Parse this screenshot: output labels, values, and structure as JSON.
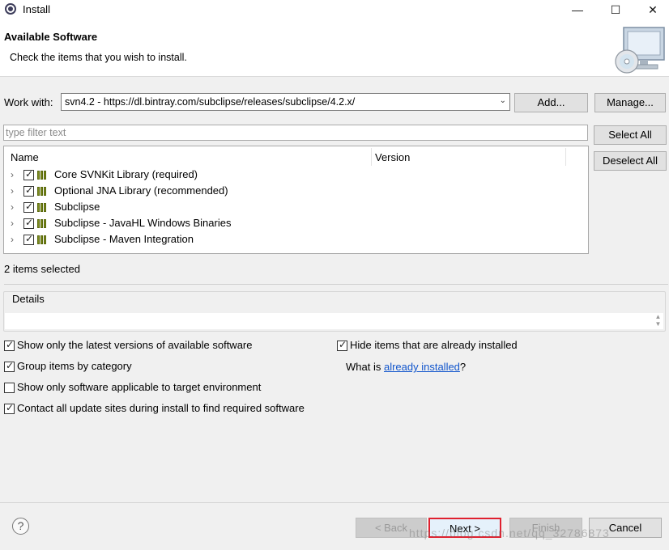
{
  "window": {
    "title": "Install",
    "minimize": "—",
    "maximize": "☐",
    "close": "✕"
  },
  "header": {
    "title": "Available Software",
    "description": "Check the items that you wish to install.",
    "banner_icon": "install-cd-monitor-icon"
  },
  "work_with": {
    "label": "Work with:",
    "value": "svn4.2 - https://dl.bintray.com/subclipse/releases/subclipse/4.2.x/",
    "add_label": "Add...",
    "manage_label": "Manage..."
  },
  "filter": {
    "placeholder": "type filter text",
    "value": ""
  },
  "side_buttons": {
    "select_all": "Select All",
    "deselect_all": "Deselect All"
  },
  "tree": {
    "columns": [
      "Name",
      "Version"
    ],
    "items": [
      {
        "label": "Core SVNKit Library (required)",
        "checked": true
      },
      {
        "label": "Optional JNA Library (recommended)",
        "checked": true
      },
      {
        "label": "Subclipse",
        "checked": true
      },
      {
        "label": "Subclipse - JavaHL Windows Binaries",
        "checked": true
      },
      {
        "label": "Subclipse - Maven Integration",
        "checked": true
      }
    ]
  },
  "status": "2 items selected",
  "details": {
    "label": "Details",
    "value": ""
  },
  "options": {
    "latest_only": {
      "label": "Show only the latest versions of available software",
      "checked": true
    },
    "group_by_category": {
      "label": "Group items by category",
      "checked": true
    },
    "target_env_only": {
      "label": "Show only software applicable to target environment",
      "checked": false
    },
    "contact_all_sites": {
      "label": "Contact all update sites during install to find required software",
      "checked": true
    },
    "hide_installed": {
      "label": "Hide items that are already installed",
      "checked": true
    }
  },
  "what_is": {
    "prefix": "What is ",
    "link": "already installed",
    "suffix": "?"
  },
  "footer": {
    "help_icon": "help-question-icon",
    "back_label": "< Back",
    "next_label": "Next >",
    "finish_label": "Finish",
    "cancel_label": "Cancel"
  },
  "watermark": "https://blog.csdn.net/qq_32786873",
  "colors": {
    "highlight_border": "#e0202e",
    "link": "#1155cc"
  }
}
